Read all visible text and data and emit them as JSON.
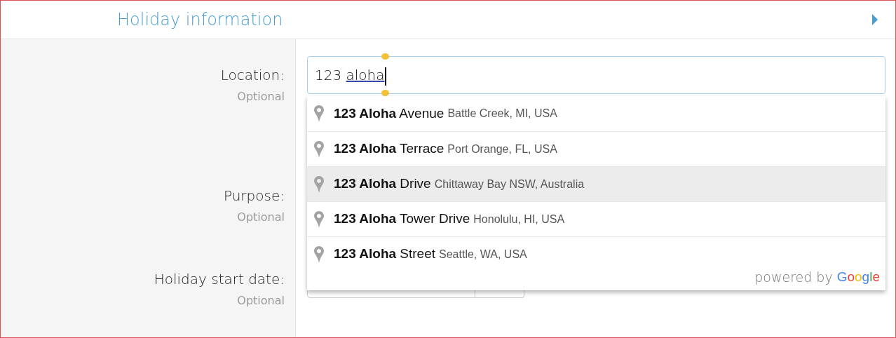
{
  "section": {
    "title": "Holiday information",
    "expanded": false
  },
  "fields": [
    {
      "label": "Location:",
      "hint": "Optional",
      "kind": "text",
      "value": "123 aloha"
    },
    {
      "label": "Purpose:",
      "hint": "Optional",
      "kind": "text"
    },
    {
      "label": "Holiday start date:",
      "hint": "Optional",
      "kind": "date"
    }
  ],
  "suggestions": [
    {
      "text": "**123 Aloha** Avenue",
      "secondary": "Battle Creek, MI, USA",
      "selected": false
    },
    {
      "text": "**123 Aloha** Terrace",
      "secondary": "Port Orange, FL, USA",
      "selected": false
    },
    {
      "text": "**123 Aloha** Drive",
      "secondary": "Chittaway Bay NSW, Australia",
      "selected": true
    },
    {
      "text": "**123 Aloha** Tower Drive",
      "secondary": "Honolulu, HI, USA",
      "selected": false
    },
    {
      "text": "**123 Aloha** Street",
      "secondary": "Seattle, WA, USA",
      "selected": false
    }
  ],
  "attribution": {
    "prefix": "powered by",
    "brand": "Google"
  }
}
